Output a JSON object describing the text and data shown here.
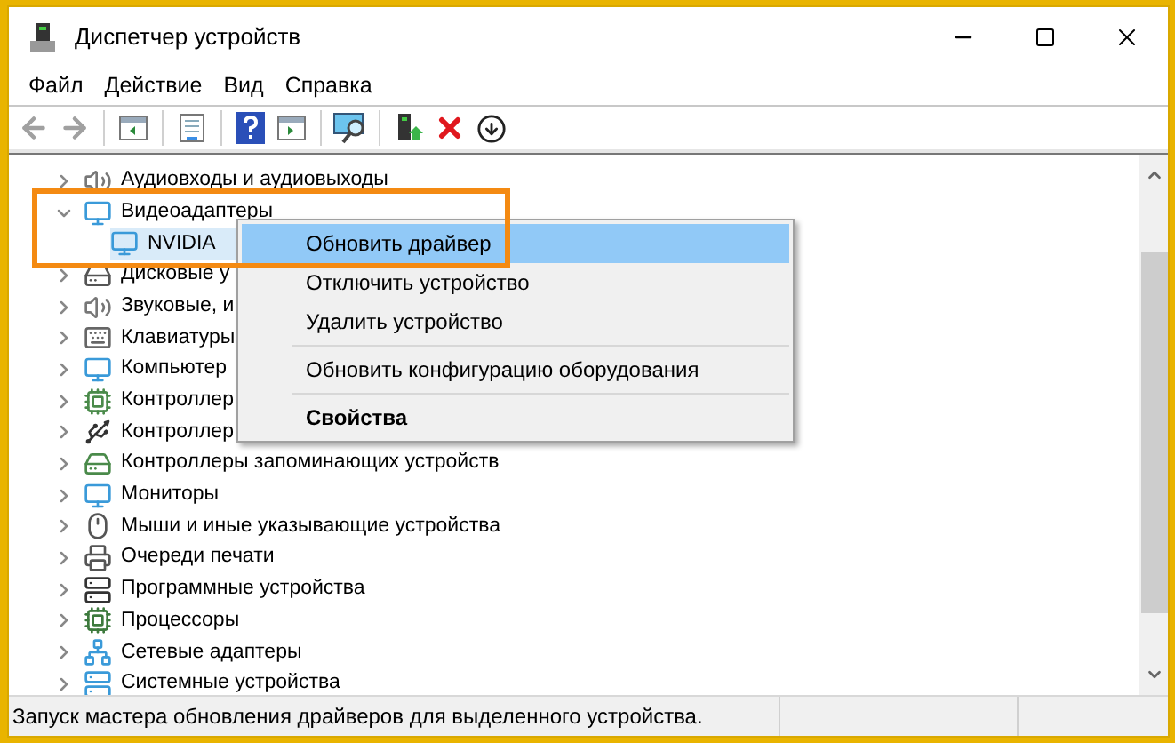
{
  "window": {
    "title": "Диспетчер устройств"
  },
  "menu": [
    {
      "label": "Файл"
    },
    {
      "label": "Действие"
    },
    {
      "label": "Вид"
    },
    {
      "label": "Справка"
    }
  ],
  "toolbar": [
    {
      "kind": "back",
      "disabled": true
    },
    {
      "kind": "forward",
      "disabled": true
    },
    {
      "kind": "sep"
    },
    {
      "kind": "tree"
    },
    {
      "kind": "sep"
    },
    {
      "kind": "properties"
    },
    {
      "kind": "sep"
    },
    {
      "kind": "help"
    },
    {
      "kind": "pane"
    },
    {
      "kind": "sep"
    },
    {
      "kind": "scan"
    },
    {
      "kind": "sep"
    },
    {
      "kind": "update"
    },
    {
      "kind": "remove"
    },
    {
      "kind": "disable"
    }
  ],
  "tree": [
    {
      "label": "Аудиовходы и аудиовыходы",
      "expanded": false,
      "selected": false
    },
    {
      "label": "Видеоадаптеры",
      "expanded": true,
      "selected": false,
      "children": [
        {
          "label": "NVIDIA",
          "selected": true
        }
      ]
    },
    {
      "label": "Дисковые у",
      "expanded": false,
      "selected": false
    },
    {
      "label": "Звуковые, и",
      "expanded": false,
      "selected": false
    },
    {
      "label": "Клавиатуры",
      "expanded": false,
      "selected": false
    },
    {
      "label": "Компьютер",
      "expanded": false,
      "selected": false
    },
    {
      "label": "Контроллер",
      "expanded": false,
      "selected": false
    },
    {
      "label": "Контроллер",
      "expanded": false,
      "selected": false
    },
    {
      "label": "Контроллеры запоминающих устройств",
      "expanded": false,
      "selected": false
    },
    {
      "label": "Мониторы",
      "expanded": false,
      "selected": false
    },
    {
      "label": "Мыши и иные указывающие устройства",
      "expanded": false,
      "selected": false
    },
    {
      "label": "Очереди печати",
      "expanded": false,
      "selected": false
    },
    {
      "label": "Программные устройства",
      "expanded": false,
      "selected": false
    },
    {
      "label": "Процессоры",
      "expanded": false,
      "selected": false
    },
    {
      "label": "Сетевые адаптеры",
      "expanded": false,
      "selected": false
    },
    {
      "label": "Системные устройства",
      "expanded": false,
      "selected": false
    }
  ],
  "context_menu": [
    {
      "kind": "item",
      "label": "Обновить драйвер",
      "selected": true,
      "bold": false
    },
    {
      "kind": "item",
      "label": "Отключить устройство",
      "selected": false,
      "bold": false
    },
    {
      "kind": "item",
      "label": "Удалить устройство",
      "selected": false,
      "bold": false
    },
    {
      "kind": "separator"
    },
    {
      "kind": "item",
      "label": "Обновить конфигурацию оборудования",
      "selected": false,
      "bold": false
    },
    {
      "kind": "separator"
    },
    {
      "kind": "item",
      "label": "Свойства",
      "selected": false,
      "bold": true
    }
  ],
  "status_bar": {
    "text": "Запуск мастера обновления драйверов для выделенного устройства."
  }
}
